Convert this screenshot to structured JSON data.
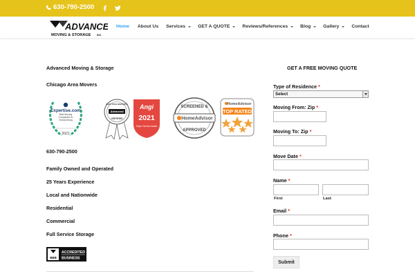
{
  "topbar": {
    "phone": "630-790-2500",
    "social": [
      "facebook-icon",
      "twitter-icon"
    ],
    "color": "#e6c31a"
  },
  "header": {
    "logo": {
      "name": "ADVANCED",
      "tagline": "MOVING & STORAGE",
      "suffix": "INC."
    },
    "nav": [
      {
        "label": "Home",
        "active": true,
        "dropdown": false
      },
      {
        "label": "About Us",
        "active": false,
        "dropdown": false
      },
      {
        "label": "Services",
        "active": false,
        "dropdown": true
      },
      {
        "label": "GET A QUOTE",
        "active": false,
        "dropdown": true
      },
      {
        "label": "Reviews/References",
        "active": false,
        "dropdown": true
      },
      {
        "label": "Blog",
        "active": false,
        "dropdown": true
      },
      {
        "label": "Gallery",
        "active": false,
        "dropdown": true
      },
      {
        "label": "Contact",
        "active": false,
        "dropdown": false
      }
    ],
    "accent": "#2ea3f2"
  },
  "left": {
    "company": "Advanced Moving & Storage",
    "area": "Chicago Area Movers",
    "phone": "630-790-2500",
    "features": [
      "Family Owned and Operated",
      "25 Years Experience",
      "Local and Nationwide",
      "Residential",
      "Commercial",
      "Full Service Storage"
    ],
    "badges": {
      "expertise": {
        "brand": "Expertise.com",
        "text": "Best Moving Companies in Schaumburg",
        "year": "2021"
      },
      "best_pick": {
        "top": "BEST PICK REPORTS",
        "middle": "Advanced",
        "bottom": "CERTIFIED"
      },
      "angi": {
        "brand": "Angi",
        "year": "2021",
        "award": "Super Service Award"
      },
      "screened": {
        "top": "SCREENED &",
        "brand": "HomeAdvisor",
        "bottom": "APPROVED"
      },
      "top_rated": {
        "brand": "HomeAdvisor",
        "label": "TOP RATED"
      }
    },
    "bbb": {
      "line1": "ACCREDITED",
      "line2": "BUSINESS",
      "logo": "BBB"
    }
  },
  "form": {
    "title": "GET A FREE MOVING QUOTE",
    "residence": {
      "label": "Type of Residence",
      "value": "Select"
    },
    "from_zip": {
      "label": "Moving From: Zip"
    },
    "to_zip": {
      "label": "Moving To: Zip"
    },
    "move_date": {
      "label": "Move Date"
    },
    "name": {
      "label": "Name",
      "first": "First",
      "last": "Last"
    },
    "email": {
      "label": "Email"
    },
    "phone": {
      "label": "Phone"
    },
    "required_mark": "*",
    "submit": "Submit"
  }
}
